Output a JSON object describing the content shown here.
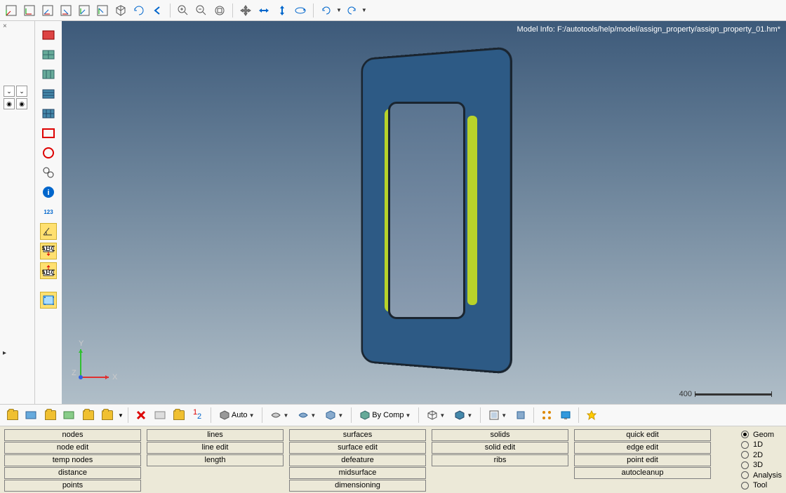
{
  "model_info": "Model Info: F:/autotools/help/model/assign_property/assign_property_01.hm*",
  "axis": {
    "x": "X",
    "y": "Y",
    "z": "Z"
  },
  "scale_value": "400",
  "mid_combos": {
    "auto": "Auto",
    "bycomp": "By Comp"
  },
  "panel_columns": [
    [
      "nodes",
      "node edit",
      "temp nodes",
      "distance",
      "points"
    ],
    [
      "lines",
      "line edit",
      "length",
      "",
      ""
    ],
    [
      "surfaces",
      "surface edit",
      "defeature",
      "midsurface",
      "dimensioning"
    ],
    [
      "solids",
      "solid edit",
      "ribs",
      "",
      ""
    ],
    [
      "quick edit",
      "edge edit",
      "point edit",
      "autocleanup",
      ""
    ]
  ],
  "radio_options": [
    "Geom",
    "1D",
    "2D",
    "3D",
    "Analysis",
    "Tool"
  ],
  "radio_selected": "Geom"
}
